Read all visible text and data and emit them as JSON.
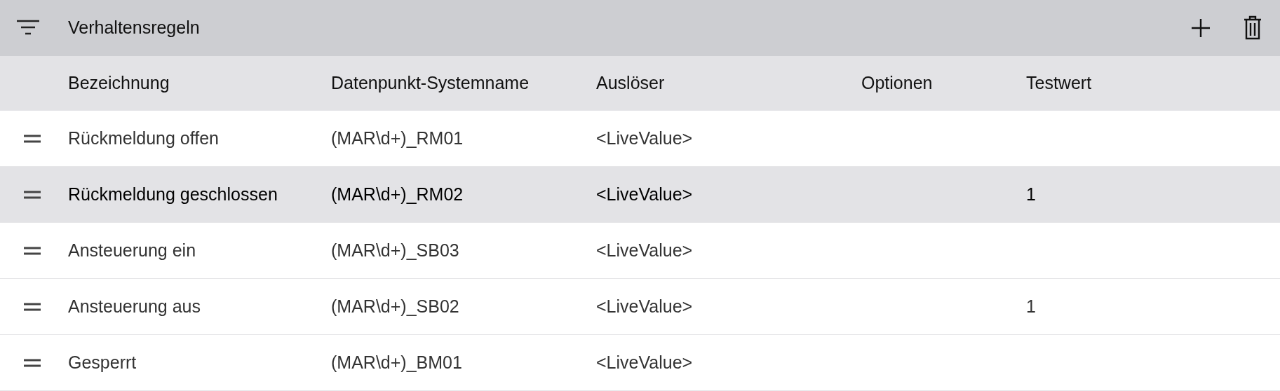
{
  "toolbar": {
    "title": "Verhaltensregeln"
  },
  "table": {
    "columns": [
      "Bezeichnung",
      "Datenpunkt-Systemname",
      "Auslöser",
      "Optionen",
      "Testwert"
    ],
    "rows": [
      {
        "selected": false,
        "cells": [
          "Rückmeldung offen",
          "(MAR\\d+)_RM01",
          "<LiveValue>",
          "",
          ""
        ]
      },
      {
        "selected": true,
        "cells": [
          "Rückmeldung geschlossen",
          "(MAR\\d+)_RM02",
          "<LiveValue>",
          "",
          "1"
        ]
      },
      {
        "selected": false,
        "cells": [
          "Ansteuerung ein",
          "(MAR\\d+)_SB03",
          "<LiveValue>",
          "",
          ""
        ]
      },
      {
        "selected": false,
        "cells": [
          "Ansteuerung aus",
          "(MAR\\d+)_SB02",
          "<LiveValue>",
          "",
          "1"
        ]
      },
      {
        "selected": false,
        "cells": [
          "Gesperrt",
          "(MAR\\d+)_BM01",
          "<LiveValue>",
          "",
          ""
        ]
      }
    ]
  }
}
